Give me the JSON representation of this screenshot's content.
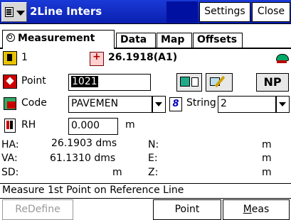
{
  "titlebar": {
    "menu_icon": "menu-list-icon",
    "title": "2Line Inters",
    "settings_label": "Settings",
    "close_label": "Close"
  },
  "tabs": [
    {
      "label": "Measurement",
      "icon": "globe-icon",
      "active": true
    },
    {
      "label": "Data"
    },
    {
      "label": "Map"
    },
    {
      "label": "Offsets"
    }
  ],
  "row1": {
    "rod_number": "1",
    "reference": "26.1918(A1)"
  },
  "point": {
    "label": "Point",
    "value": "1021",
    "np_label": "NP"
  },
  "code": {
    "label": "Code",
    "value": "PAVEMEN",
    "string_label": "String",
    "string_value": "2"
  },
  "rh": {
    "label": "RH",
    "value": "0.000",
    "unit": "m"
  },
  "readings": {
    "ha_label": "HA:",
    "ha_value": "26.1903 dms",
    "va_label": "VA:",
    "va_value": "61.1310 dms",
    "sd_label": "SD:",
    "sd_value": "m",
    "n_label": "N:",
    "n_value": "m",
    "e_label": "E:",
    "e_value": "m",
    "z_label": "Z:",
    "z_value": "m"
  },
  "status": "Measure 1st Point on Reference Line",
  "buttons": {
    "redefine": "ReDefine",
    "point": "Point",
    "meas": "Meas"
  },
  "colors": {
    "titlebar": "#1a3ad6",
    "accent_red": "#c00000"
  }
}
